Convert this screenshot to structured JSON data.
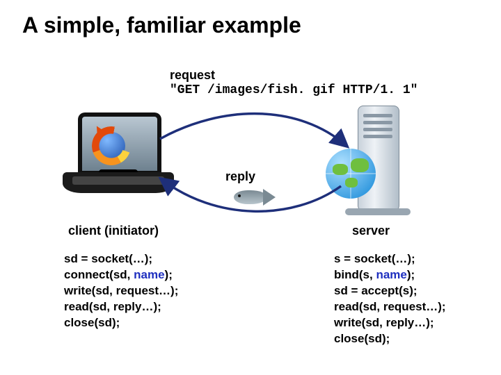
{
  "title": "A simple, familiar example",
  "request": {
    "label": "request",
    "text": "\"GET /images/fish. gif HTTP/1. 1\""
  },
  "reply_label": "reply",
  "client_label": "client (initiator)",
  "server_label": "server",
  "client_code": [
    {
      "pre": "sd = socket(…);",
      "kw": "",
      "post": ""
    },
    {
      "pre": "connect(sd, ",
      "kw": "name",
      "post": ");"
    },
    {
      "pre": "write(sd, request…);",
      "kw": "",
      "post": ""
    },
    {
      "pre": "read(sd, reply…);",
      "kw": "",
      "post": ""
    },
    {
      "pre": "close(sd);",
      "kw": "",
      "post": ""
    }
  ],
  "server_code": [
    {
      "pre": "s = socket(…);",
      "kw": "",
      "post": ""
    },
    {
      "pre": "bind(s, ",
      "kw": "name",
      "post": ");"
    },
    {
      "pre": "sd = accept(s);",
      "kw": "",
      "post": ""
    },
    {
      "pre": "read(sd, request…);",
      "kw": "",
      "post": ""
    },
    {
      "pre": "write(sd, reply…);",
      "kw": "",
      "post": ""
    },
    {
      "pre": "close(sd);",
      "kw": "",
      "post": ""
    }
  ],
  "colors": {
    "arrow": "#1e2f7a",
    "keyword": "#1e2fbf"
  }
}
